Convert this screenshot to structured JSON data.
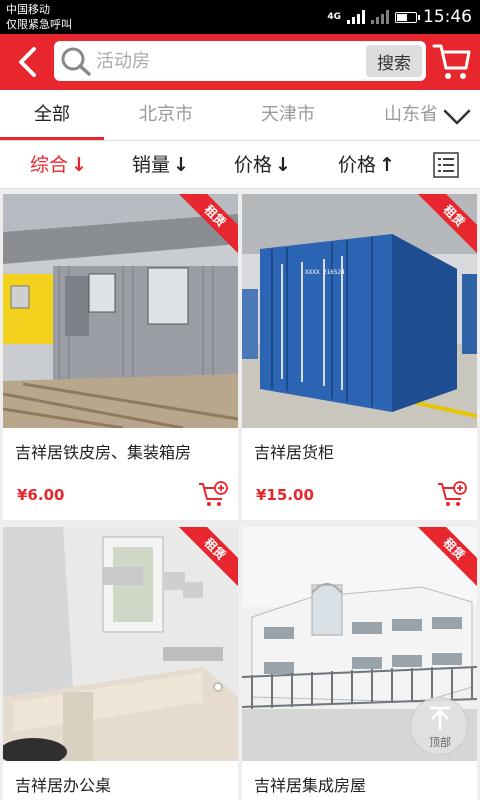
{
  "status_bar": {
    "carrier": "中国移动",
    "emergency": "仅限紧急呼叫",
    "network": "4G",
    "time": "15:46"
  },
  "header": {
    "search_placeholder": "活动房",
    "search_button": "搜索"
  },
  "city_tabs": [
    "全部",
    "北京市",
    "天津市",
    "山东省"
  ],
  "sort": {
    "items": [
      {
        "label": "综合",
        "arrow": "↓"
      },
      {
        "label": "销量",
        "arrow": "↓"
      },
      {
        "label": "价格",
        "arrow": "↓"
      },
      {
        "label": "价格",
        "arrow": "↑"
      }
    ]
  },
  "products": [
    {
      "title": "吉祥居铁皮房、集装箱房",
      "price": "¥6.00",
      "badge": "租赁"
    },
    {
      "title": "吉祥居货柜",
      "price": "¥15.00",
      "badge": "租赁"
    },
    {
      "title": "吉祥居办公桌",
      "price": "",
      "badge": "租赁"
    },
    {
      "title": "吉祥居集成房屋",
      "price": "",
      "badge": "租赁"
    }
  ],
  "back_to_top": "顶部",
  "colors": {
    "accent": "#e8262d",
    "background": "#eeeeee"
  }
}
